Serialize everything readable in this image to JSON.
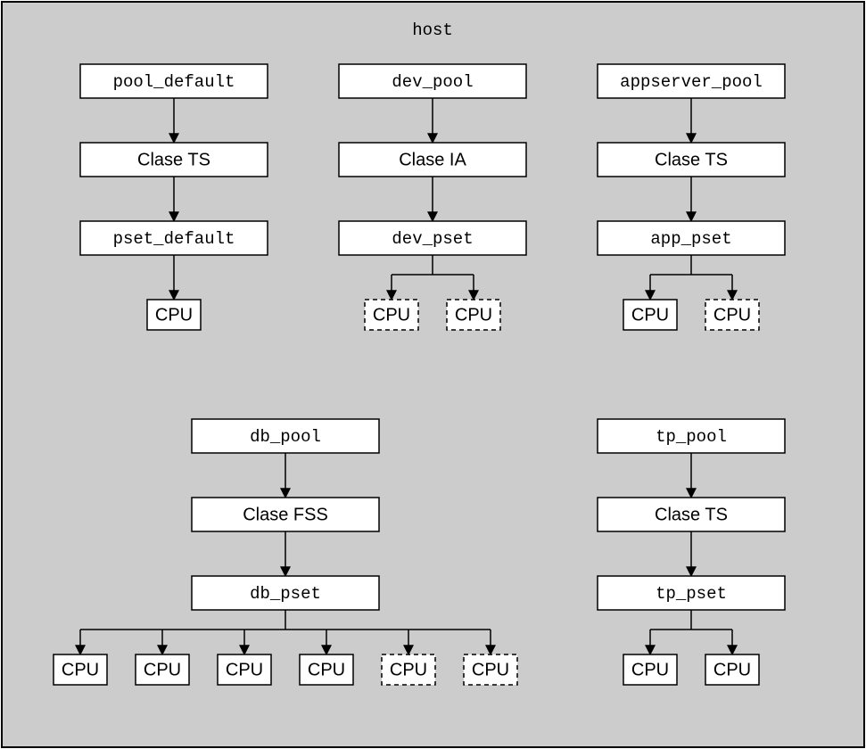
{
  "title": "host",
  "cpu_label": "CPU",
  "pools": {
    "top": [
      {
        "pool": "pool_default",
        "class": "Clase TS",
        "pset": "pset_default",
        "cpus": [
          {
            "dashed": false
          }
        ]
      },
      {
        "pool": "dev_pool",
        "class": "Clase IA",
        "pset": "dev_pset",
        "cpus": [
          {
            "dashed": true
          },
          {
            "dashed": true
          }
        ]
      },
      {
        "pool": "appserver_pool",
        "class": "Clase TS",
        "pset": "app_pset",
        "cpus": [
          {
            "dashed": false
          },
          {
            "dashed": true
          }
        ]
      }
    ],
    "bottom": [
      {
        "pool": "db_pool",
        "class": "Clase FSS",
        "pset": "db_pset",
        "cpus": [
          {
            "dashed": false
          },
          {
            "dashed": false
          },
          {
            "dashed": false
          },
          {
            "dashed": false
          },
          {
            "dashed": true
          },
          {
            "dashed": true
          }
        ]
      },
      {
        "pool": "tp_pool",
        "class": "Clase TS",
        "pset": "tp_pset",
        "cpus": [
          {
            "dashed": false
          },
          {
            "dashed": false
          }
        ]
      }
    ]
  }
}
